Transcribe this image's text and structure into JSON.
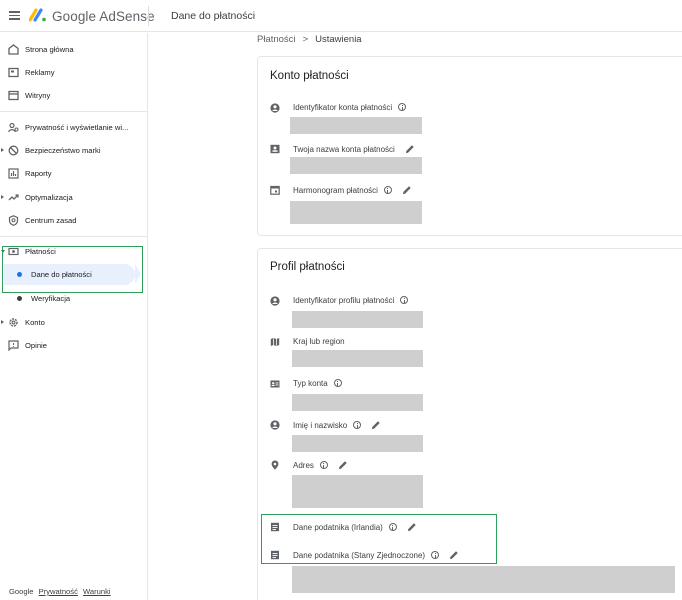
{
  "app": {
    "brand": "Google AdSense",
    "page_title": "Dane do płatności"
  },
  "sidebar": {
    "items": [
      {
        "label": "Strona główna",
        "icon": "home-icon"
      },
      {
        "label": "Reklamy",
        "icon": "ads-icon"
      },
      {
        "label": "Witryny",
        "icon": "sites-icon"
      },
      {
        "label": "Prywatność i wyświetlanie wi...",
        "icon": "privacy-icon"
      },
      {
        "label": "Bezpieczeństwo marki",
        "icon": "block-icon"
      },
      {
        "label": "Raporty",
        "icon": "reports-icon"
      },
      {
        "label": "Optymalizacja",
        "icon": "trending-icon"
      },
      {
        "label": "Centrum zasad",
        "icon": "policy-shield-icon"
      },
      {
        "label": "Płatności",
        "icon": "payments-icon"
      },
      {
        "label": "Dane do płatności",
        "icon": "dot"
      },
      {
        "label": "Weryfikacja",
        "icon": "dot"
      },
      {
        "label": "Konto",
        "icon": "gear-icon"
      },
      {
        "label": "Opinie",
        "icon": "feedback-icon"
      }
    ],
    "footer": {
      "google": "Google",
      "privacy": "Prywatność",
      "terms": "Warunki"
    }
  },
  "breadcrumb": {
    "parent": "Płatności",
    "separator": ">",
    "current": "Ustawienia"
  },
  "account_card": {
    "title": "Konto płatności",
    "fields": [
      {
        "label": "Identyfikator konta płatności",
        "icon": "account-circle-icon"
      },
      {
        "label": "Twoja nazwa konta płatności",
        "icon": "badge-icon"
      },
      {
        "label": "Harmonogram płatności",
        "icon": "calendar-icon"
      }
    ]
  },
  "profile_card": {
    "title": "Profil płatności",
    "fields": [
      {
        "label": "Identyfikator profilu płatności",
        "icon": "account-circle-icon"
      },
      {
        "label": "Kraj lub region",
        "icon": "map-icon"
      },
      {
        "label": "Typ konta",
        "icon": "id-card-icon"
      },
      {
        "label": "Imię i nazwisko",
        "icon": "account-circle-icon"
      },
      {
        "label": "Adres",
        "icon": "location-pin-icon"
      },
      {
        "label": "Dane podatnika (Irlandia)",
        "icon": "document-icon"
      },
      {
        "label": "Dane podatnika (Stany Zjednoczone)",
        "icon": "document-icon"
      }
    ]
  },
  "colors": {
    "highlight_border": "#2e9e5b",
    "active_bg": "#e8f0fe",
    "active_dot": "#1a73e8",
    "redacted": "#cfcfcf"
  }
}
